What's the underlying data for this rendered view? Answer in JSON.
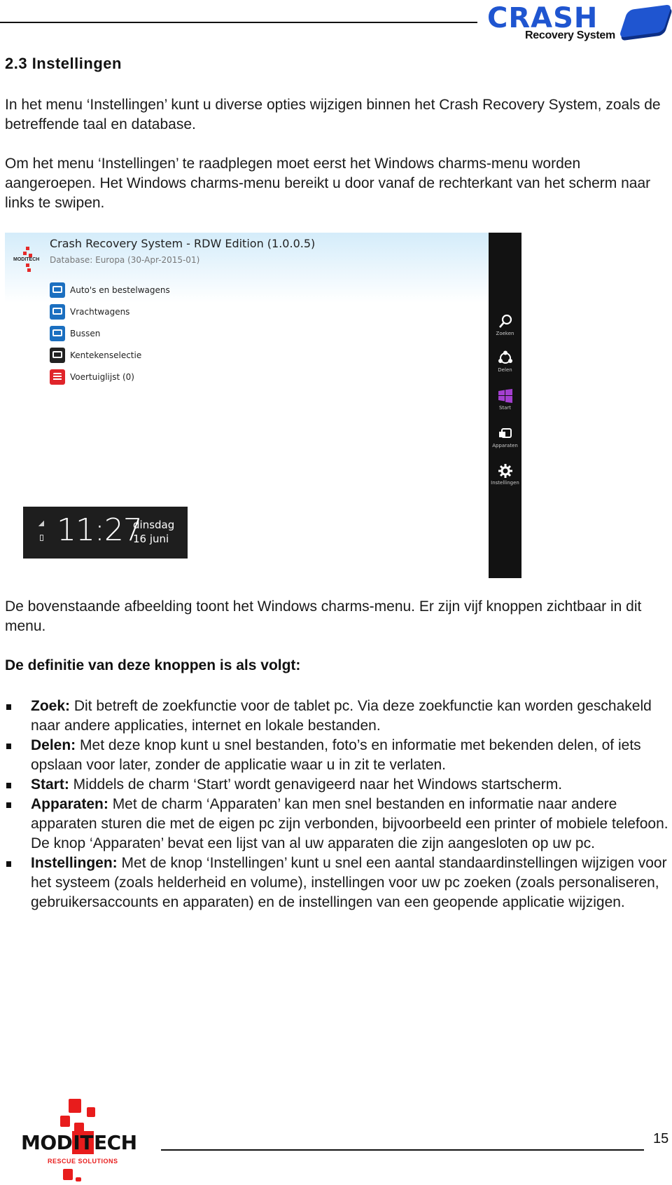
{
  "header": {
    "brand_main": "CRASH",
    "brand_sub": "Recovery System"
  },
  "section": {
    "heading": "2.3 Instellingen",
    "paragraphs": [
      "In het menu ‘Instellingen’ kunt u diverse opties wijzigen binnen het Crash Recovery System, zoals de betreffende taal en database.",
      "Om het menu ‘Instellingen’ te raadplegen moet eerst het Windows charms-menu worden aangeroepen. Het Windows charms-menu bereikt u door vanaf de rechterkant van het scherm naar links te swipen.",
      "De bovenstaande afbeelding toont het Windows charms-menu. Er zijn vijf knoppen zichtbaar in dit menu."
    ],
    "definitions_heading": "De definitie van deze knoppen is als volgt:",
    "definitions": [
      {
        "term": "Zoek:",
        "text": " Dit betreft de zoekfunctie voor de tablet pc. Via deze zoekfunctie kan worden geschakeld naar andere applicaties, internet en lokale bestanden."
      },
      {
        "term": "Delen:",
        "text": " Met deze knop kunt u snel bestanden, foto’s en informatie met bekenden delen, of iets opslaan voor later, zonder de applicatie waar u in zit te verlaten."
      },
      {
        "term": "Start:",
        "text": " Middels de charm ‘Start’ wordt genavigeerd naar het Windows startscherm."
      },
      {
        "term": "Apparaten:",
        "text": " Met de charm ‘Apparaten’ kan men snel bestanden en informatie naar andere apparaten sturen die met de eigen pc zijn verbonden, bijvoorbeeld een printer of mobiele telefoon. De knop ‘Apparaten’ bevat een lijst van al uw apparaten die zijn aangesloten op uw pc."
      },
      {
        "term": "Instellingen:",
        "text": " Met de knop ‘Instellingen’ kunt u snel een aantal standaardinstellingen wijzigen voor het systeem (zoals helderheid en volume), instellingen voor uw pc zoeken (zoals personaliseren, gebruikersaccounts en apparaten) en de instellingen van een geopende applicatie wijzigen."
      }
    ]
  },
  "screenshot": {
    "app_logo_text": "MODITECH",
    "app_title": "Crash Recovery System - RDW Edition (1.0.0.5)",
    "database": "Database: Europa (30-Apr-2015-01)",
    "menu": [
      {
        "label": "Auto's en bestelwagens",
        "icon": "car-icon",
        "color": "#1b6fc0"
      },
      {
        "label": "Vrachtwagens",
        "icon": "truck-icon",
        "color": "#1b6fc0"
      },
      {
        "label": "Bussen",
        "icon": "bus-icon",
        "color": "#1b6fc0"
      },
      {
        "label": "Kentekenselectie",
        "icon": "license-plate-icon",
        "color": "#222222"
      },
      {
        "label": "Voertuiglijst (0)",
        "icon": "list-icon",
        "color": "#e0242a"
      }
    ],
    "clock": {
      "time": "11:27",
      "weekday": "dinsdag",
      "date": "16 juni"
    },
    "charms": [
      {
        "label": "Zoeken",
        "icon": "search-icon"
      },
      {
        "label": "Delen",
        "icon": "share-icon"
      },
      {
        "label": "Start",
        "icon": "windows-start-icon",
        "color": "#a43fd0"
      },
      {
        "label": "Apparaten",
        "icon": "devices-icon"
      },
      {
        "label": "Instellingen",
        "icon": "gear-icon"
      }
    ]
  },
  "footer": {
    "logo_text_pre": "MOD",
    "logo_text_it": "IT",
    "logo_text_post": "ECH",
    "logo_tagline": "RESCUE SOLUTIONS",
    "page_number": "15"
  }
}
